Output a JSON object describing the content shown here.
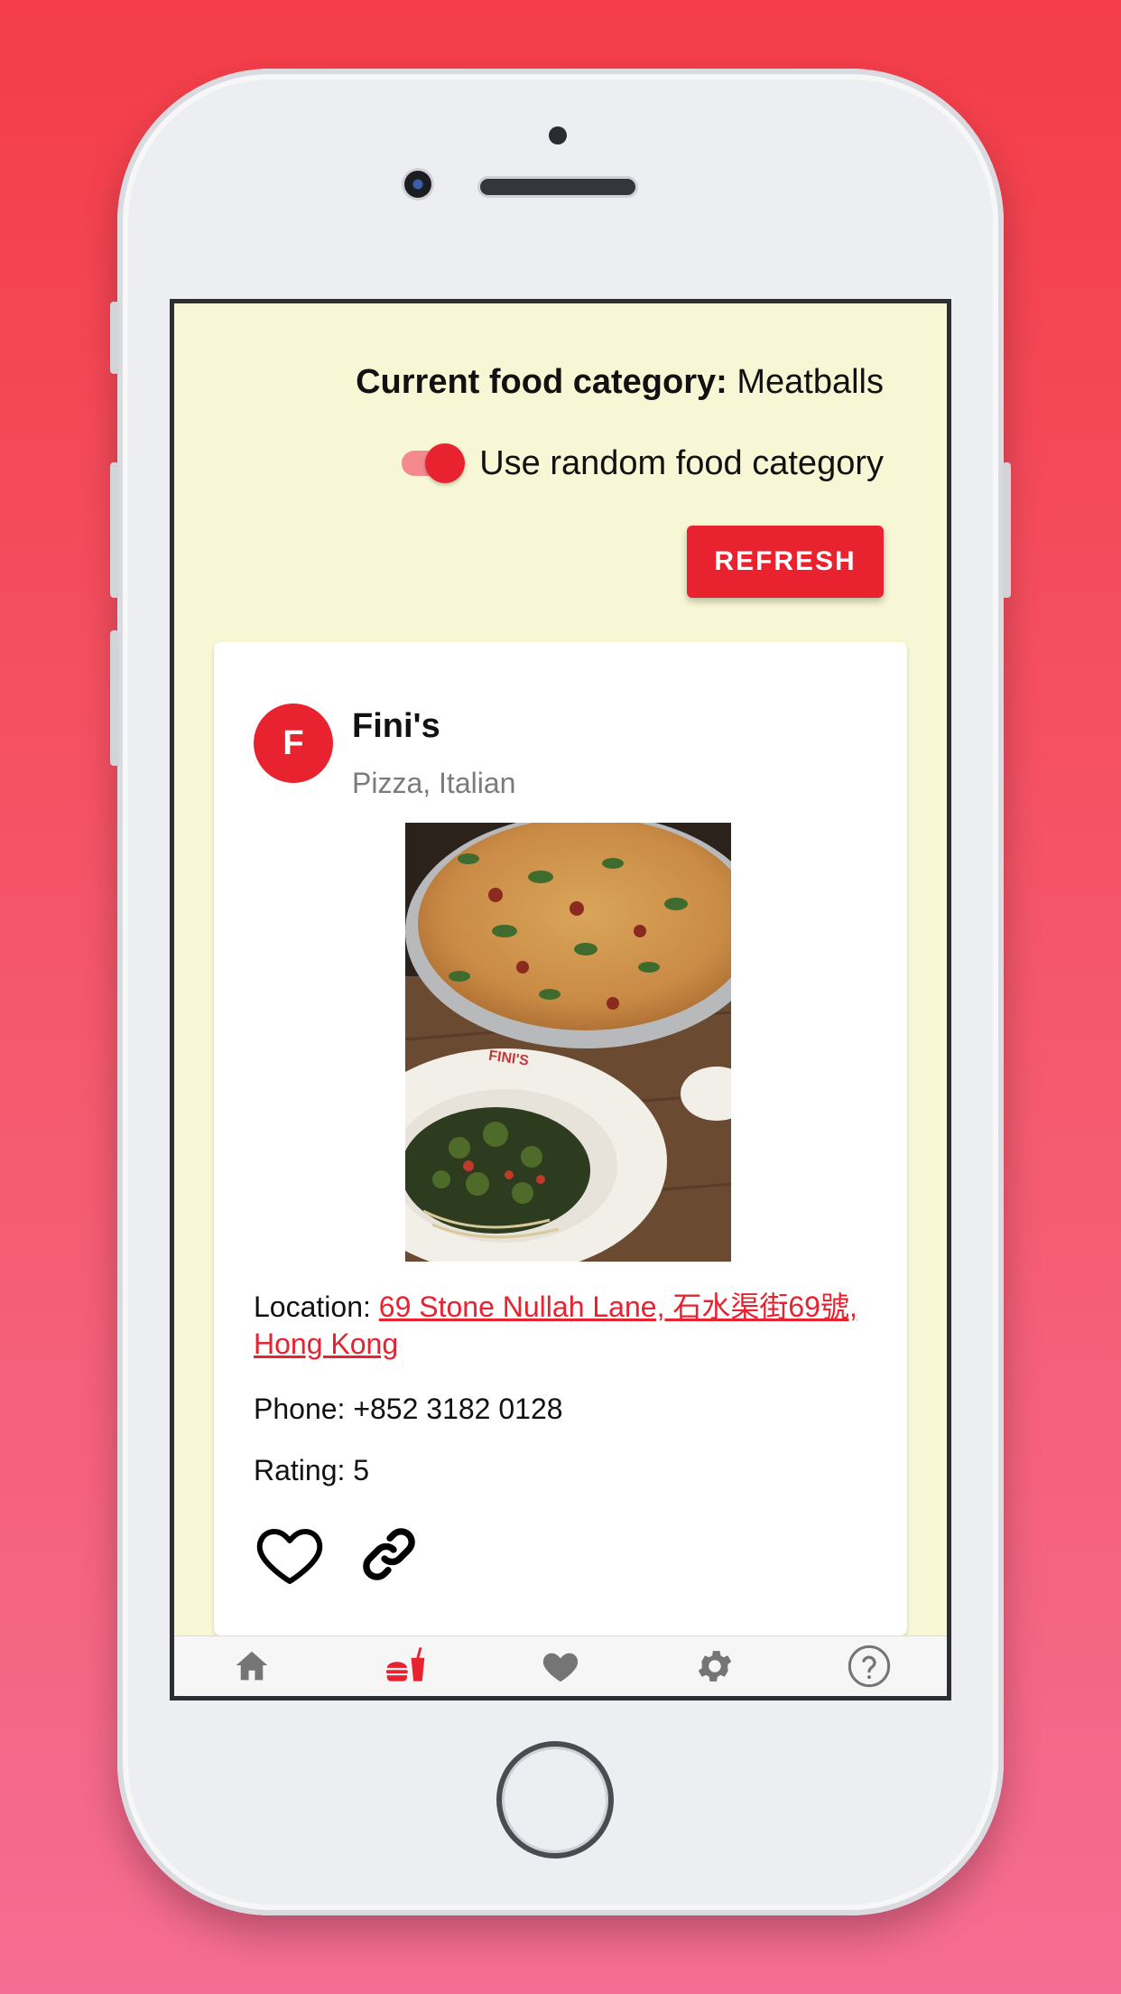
{
  "header": {
    "category_label": "Current food category:",
    "category_value": "Meatballs",
    "random_toggle_label": "Use random food category",
    "random_toggle_on": true,
    "refresh_label": "REFRESH"
  },
  "card": {
    "avatar_letter": "F",
    "name": "Fini's",
    "categories": "Pizza, Italian",
    "location_label": "Location:",
    "location_value": "69 Stone Nullah Lane, 石水渠街69號, Hong Kong",
    "phone_label": "Phone:",
    "phone_value": "+852 3182 0128",
    "rating_label": "Rating:",
    "rating_value": "5",
    "photo_plate_text": "FINI'S"
  },
  "nav": {
    "items": [
      {
        "icon": "home-icon",
        "active": false
      },
      {
        "icon": "food-icon",
        "active": true
      },
      {
        "icon": "heart-icon",
        "active": false
      },
      {
        "icon": "gear-icon",
        "active": false
      },
      {
        "icon": "help-icon",
        "active": false
      }
    ]
  },
  "colors": {
    "accent": "#e8222f",
    "screen_bg": "#f7f7d5",
    "nav_inactive": "#757575"
  }
}
